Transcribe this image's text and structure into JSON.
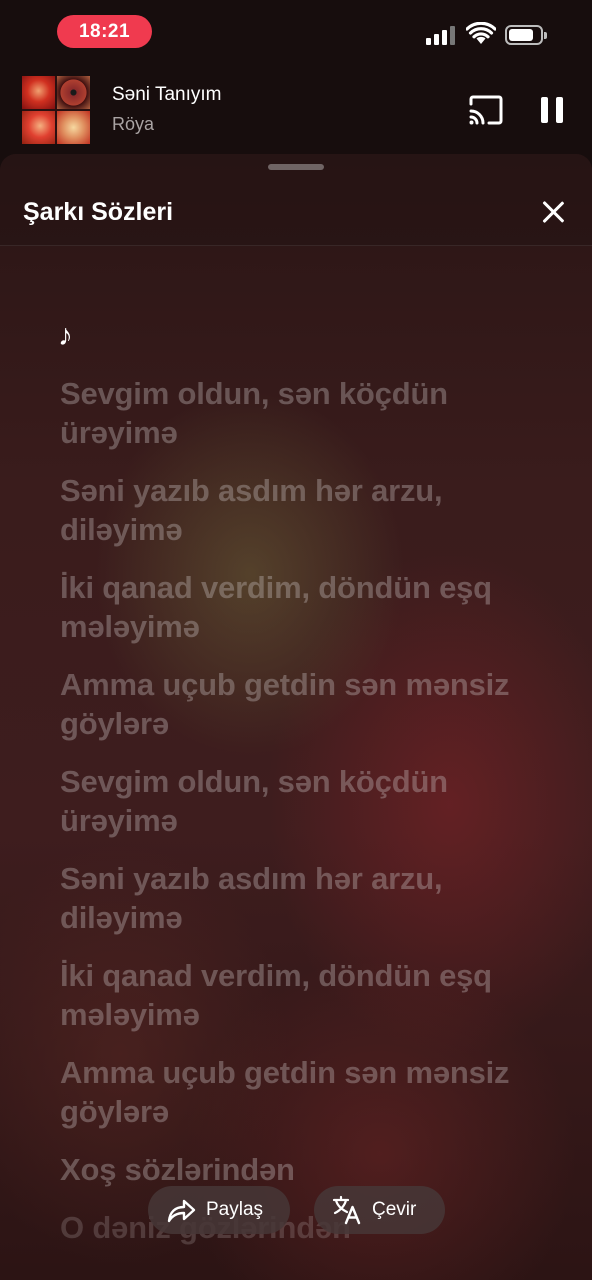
{
  "status_bar": {
    "time": "18:21"
  },
  "now_playing": {
    "title": "Səni Tanıyım",
    "artist": "Röya"
  },
  "sheet": {
    "title": "Şarkı Sözleri",
    "note_glyph": "♪",
    "lyrics": [
      "Sevgim oldun, sən köçdün ürəyimə",
      "Səni yazıb asdım hər arzu, diləyimə",
      "İki qanad verdim, döndün eşq mələyimə",
      "Amma uçub getdin sən mənsiz göylərə",
      "Sevgim oldun, sən köçdün ürəyimə",
      "Səni yazıb asdım hər arzu, diləyimə",
      "İki qanad verdim, döndün eşq mələyimə",
      "Amma uçub getdin sən mənsiz göylərə",
      "Xoş sözlərindən",
      "O dəniz gözlərindən"
    ]
  },
  "actions": {
    "share_label": "Paylaş",
    "translate_label": "Çevir"
  }
}
